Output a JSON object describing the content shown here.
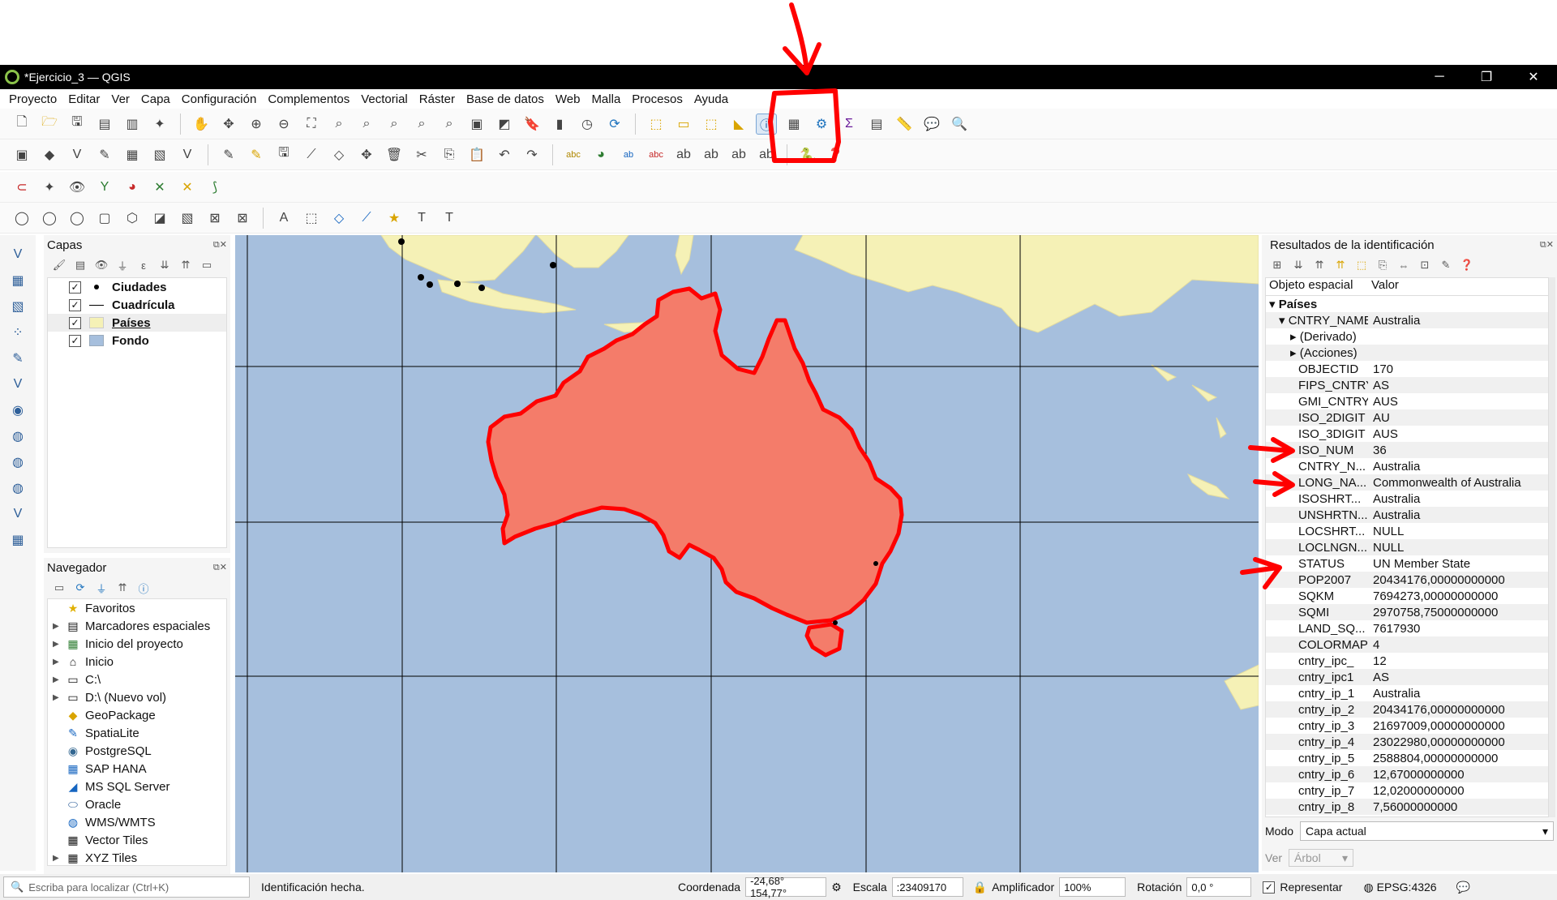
{
  "window": {
    "title": "*Ejercicio_3 — QGIS",
    "minimize": "─",
    "restore": "❐",
    "close": "✕"
  },
  "menu": [
    "Proyecto",
    "Editar",
    "Ver",
    "Capa",
    "Configuración",
    "Complementos",
    "Vectorial",
    "Ráster",
    "Base de datos",
    "Web",
    "Malla",
    "Procesos",
    "Ayuda"
  ],
  "layers_panel": {
    "title": "Capas",
    "items": [
      {
        "label": "Ciudades",
        "checked": "✓"
      },
      {
        "label": "Cuadrícula",
        "checked": "✓"
      },
      {
        "label": "Países",
        "checked": "✓"
      },
      {
        "label": "Fondo",
        "checked": "✓"
      }
    ]
  },
  "browser_panel": {
    "title": "Navegador",
    "items": [
      {
        "label": "Favoritos",
        "icon": "★"
      },
      {
        "label": "Marcadores espaciales",
        "icon": "▤"
      },
      {
        "label": "Inicio del proyecto",
        "icon": "▦"
      },
      {
        "label": "Inicio",
        "icon": "⌂"
      },
      {
        "label": "C:\\",
        "icon": "▭"
      },
      {
        "label": "D:\\ (Nuevo vol)",
        "icon": "▭"
      },
      {
        "label": "GeoPackage",
        "icon": "◆"
      },
      {
        "label": "SpatiaLite",
        "icon": "✎"
      },
      {
        "label": "PostgreSQL",
        "icon": "◉"
      },
      {
        "label": "SAP HANA",
        "icon": "▦"
      },
      {
        "label": "MS SQL Server",
        "icon": "◢"
      },
      {
        "label": "Oracle",
        "icon": "⬭"
      },
      {
        "label": "WMS/WMTS",
        "icon": "◍"
      },
      {
        "label": "Vector Tiles",
        "icon": "▦"
      },
      {
        "label": "XYZ Tiles",
        "icon": "▦"
      }
    ]
  },
  "ident_panel": {
    "title": "Resultados de la identificación",
    "col_feature": "Objeto espacial",
    "col_value": "Valor",
    "layer": "Países",
    "feature_key": "CNTRY_NAME",
    "feature_value": "Australia",
    "derived": "(Derivado)",
    "actions": "(Acciones)",
    "attributes": [
      {
        "k": "OBJECTID",
        "v": "170"
      },
      {
        "k": "FIPS_CNTRY",
        "v": "AS"
      },
      {
        "k": "GMI_CNTRY",
        "v": "AUS"
      },
      {
        "k": "ISO_2DIGIT",
        "v": "AU"
      },
      {
        "k": "ISO_3DIGIT",
        "v": "AUS"
      },
      {
        "k": "ISO_NUM",
        "v": "36"
      },
      {
        "k": "CNTRY_N...",
        "v": "Australia"
      },
      {
        "k": "LONG_NA...",
        "v": "Commonwealth of Australia"
      },
      {
        "k": "ISOSHRT...",
        "v": "Australia"
      },
      {
        "k": "UNSHRTN...",
        "v": "Australia"
      },
      {
        "k": "LOCSHRT...",
        "v": "NULL"
      },
      {
        "k": "LOCLNGN...",
        "v": "NULL"
      },
      {
        "k": "STATUS",
        "v": "UN Member State"
      },
      {
        "k": "POP2007",
        "v": "20434176,00000000000"
      },
      {
        "k": "SQKM",
        "v": "7694273,00000000000"
      },
      {
        "k": "SQMI",
        "v": "2970758,75000000000"
      },
      {
        "k": "LAND_SQ...",
        "v": "7617930"
      },
      {
        "k": "COLORMAP",
        "v": "4"
      },
      {
        "k": "cntry_ipc_",
        "v": "12"
      },
      {
        "k": "cntry_ipc1",
        "v": "AS"
      },
      {
        "k": "cntry_ip_1",
        "v": "Australia"
      },
      {
        "k": "cntry_ip_2",
        "v": "20434176,00000000000"
      },
      {
        "k": "cntry_ip_3",
        "v": "21697009,00000000000"
      },
      {
        "k": "cntry_ip_4",
        "v": "23022980,00000000000"
      },
      {
        "k": "cntry_ip_5",
        "v": "2588804,00000000000"
      },
      {
        "k": "cntry_ip_6",
        "v": "12,67000000000"
      },
      {
        "k": "cntry_ip_7",
        "v": "12,02000000000"
      },
      {
        "k": "cntry_ip_8",
        "v": "7,56000000000"
      }
    ],
    "mode_label": "Modo",
    "mode_value": "Capa actual",
    "view_label": "Ver",
    "view_value": "Árbol"
  },
  "status": {
    "locator_placeholder": "Escriba para localizar (Ctrl+K)",
    "message": "Identificación hecha.",
    "coord_label": "Coordenada",
    "coord_value": "-24,68° 154,77°",
    "scale_label": "Escala",
    "scale_value": ":23409170",
    "magnifier_label": "Amplificador",
    "magnifier_value": "100%",
    "rotation_label": "Rotación",
    "rotation_value": "0,0 °",
    "render_label": "Representar",
    "crs": "EPSG:4326"
  },
  "colors": {
    "sea": "#a6bfdd",
    "land": "#f5f1b6",
    "selected": "#f47c6a",
    "highlight": "#ff0000"
  }
}
